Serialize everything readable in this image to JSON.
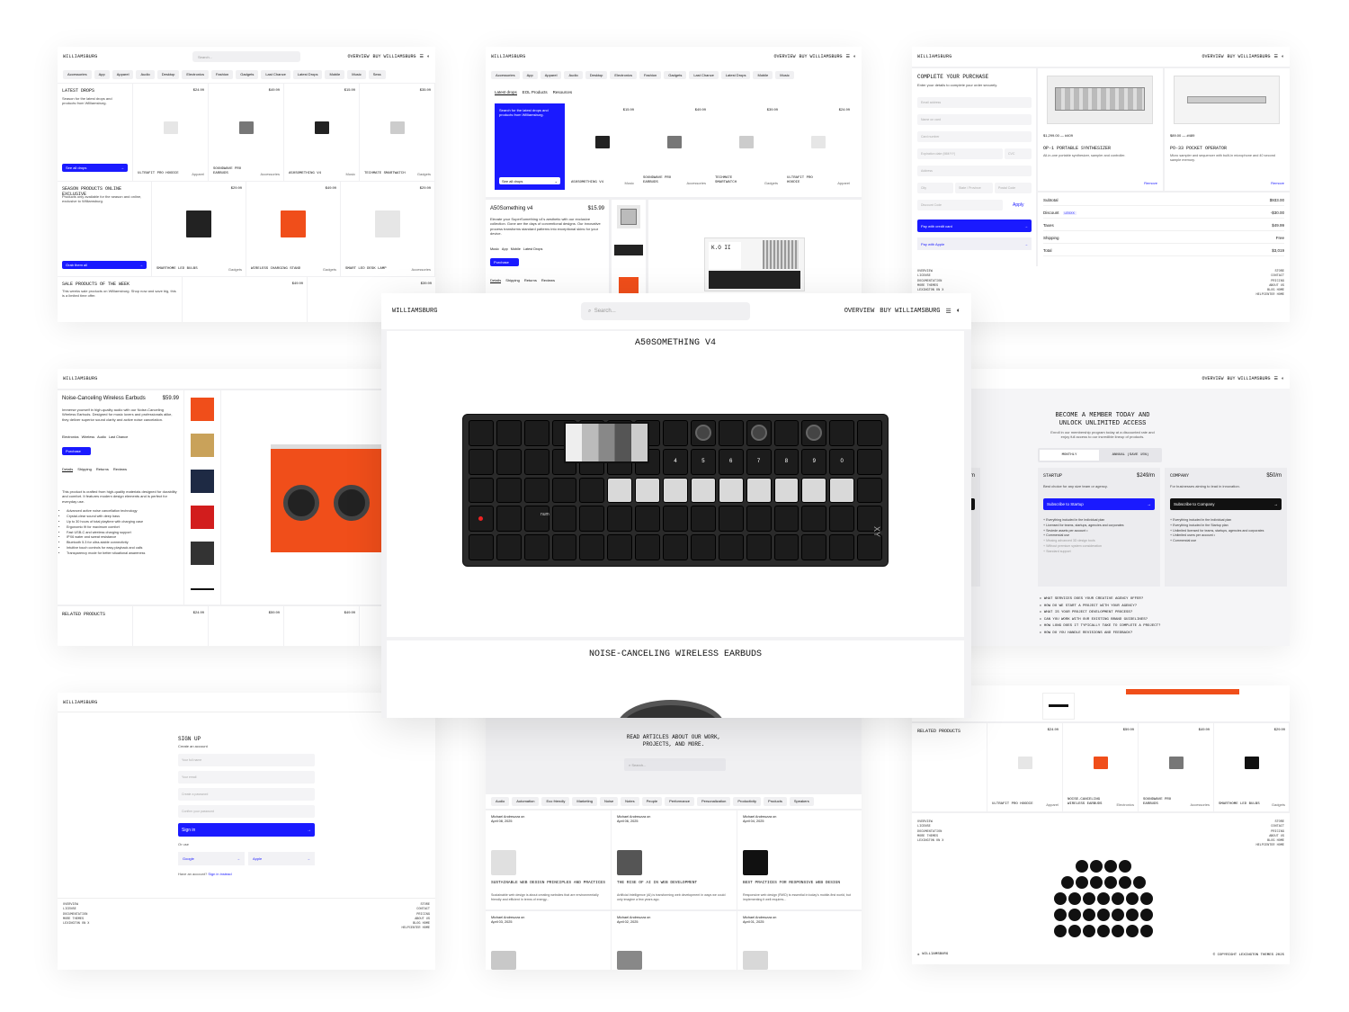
{
  "colors": {
    "accent": "#1a1aff",
    "orange": "#f04e1a",
    "bg": "#f0f0f2"
  },
  "brand": "WILLIAMSBURG",
  "nav": {
    "overview": "OVERVIEW",
    "buy": "BUY WILLIAMSBURG",
    "search_placeholder": "Search..."
  },
  "shop": {
    "chips": [
      "Accessories",
      "App",
      "Apparel",
      "Audio",
      "Desktop",
      "Electronics",
      "Fashion",
      "Gadgets",
      "Last Chance",
      "Latest Drops",
      "Mobile",
      "Music",
      "Sess"
    ],
    "latest_title": "LATEST DROPS",
    "latest_desc": "Season for the latest drops and products from Williamsburg.",
    "see_all": "See all drops",
    "row1": [
      {
        "price": "$24.99",
        "name": "ULTRAFIT PRO HOODIE",
        "cat": "Apparel"
      },
      {
        "price": "$49.99",
        "name": "SOUNDWAVE PRO EARBUDS",
        "cat": "Accessories"
      },
      {
        "price": "$15.99",
        "name": "A50SOMETHING V4",
        "cat": "Music"
      },
      {
        "price": "$35.99",
        "name": "TECHMATE SMARTWATCH",
        "cat": "Gadgets"
      }
    ],
    "season_title": "SEASON PRODUCTS ONLINE EXCLUSIVE",
    "season_desc": "Products only available for the season and online, exclusive to Williamsburg.",
    "grab": "Grab them all",
    "row2": [
      {
        "price": "$29.99",
        "name": "SMARTHOME LED BULBS",
        "cat": "Gadgets"
      },
      {
        "price": "$49.99",
        "name": "WIRELESS CHARGING STAND",
        "cat": "Gadgets"
      },
      {
        "price": "$29.99",
        "name": "SMART LED DESK LAMP",
        "cat": "Accessories"
      }
    ],
    "sale_title": "SALE PRODUCTS OF THE WEEK",
    "sale_desc": "This weeks sale products on Williamsburg. Shop now and save big, this is a limited time offer.",
    "sale_price1": "$49.99",
    "sale_price2": "$39.99"
  },
  "store": {
    "chips": [
      "Accessories",
      "App",
      "Apparel",
      "Audio",
      "Desktop",
      "Electronics",
      "Fashion",
      "Gadgets",
      "Last Chance",
      "Latest Drops",
      "Mobile",
      "Music"
    ],
    "tabs": [
      "Latest drops",
      "EOL Products",
      "Resources"
    ],
    "promo": "Search for the latest drops and products from Williamsburg.",
    "see_all": "See all drops",
    "items": [
      {
        "price": "$15.99",
        "name": "A50SOMETHING V4",
        "cat": "Music"
      },
      {
        "price": "$49.99",
        "name": "SOUNDWAVE PRO EARBUDS",
        "cat": "Accessories"
      },
      {
        "price": "$39.99",
        "name": "TECHMATE SMARTWATCH",
        "cat": "Gadgets"
      },
      {
        "price": "$24.99",
        "name": "ULTRAFIT PRO HOODIE",
        "cat": "Apparel"
      }
    ],
    "product_name": "A50Something v4",
    "product_price": "$15.99",
    "product_desc": "Elevate your SuperSomething v4's aesthetic with our exclusive collection. Gone are the days of conventional designs. Our innovative process transforms standard patterns into exceptional skins for your device.",
    "tags": [
      "Music",
      "App",
      "Mobile",
      "Latest Drops"
    ],
    "purchase": "Purchase",
    "detail_tabs": [
      "Details",
      "Shipping",
      "Returns",
      "Reviews"
    ]
  },
  "checkout": {
    "title": "COMPLETE YOUR PURCHASE",
    "subtitle": "Enter your details to complete your order securely.",
    "fields": [
      "Email address",
      "Name on card",
      "Card number",
      "Expiration date (MM/YY)",
      "CVC",
      "Address",
      "City",
      "State / Province",
      "Postal Code",
      "Discount Code"
    ],
    "apply": "Apply",
    "pay_card": "Pay with credit card",
    "pay_apple": "Pay with Apple",
    "items": [
      {
        "price": "$1,299.00 — #409",
        "name": "OP-1 PORTABLE SYNTHESIZER",
        "desc": "All-in-one portable synthesizer, sampler and controller.",
        "remove": "Remove"
      },
      {
        "price": "$89.00 — #489",
        "name": "PO-33 POCKET OPERATOR",
        "desc": "Micro sampler and sequencer with built-in microphone and 40 second sample memory.",
        "remove": "Remove"
      }
    ],
    "summary": [
      {
        "label": "Subtotal",
        "value": "$933.00"
      },
      {
        "label": "Discount",
        "value": "-$30.00",
        "badge": "LEXXX"
      },
      {
        "label": "Taxes",
        "value": "$49.99"
      },
      {
        "label": "Shipping",
        "value": "Free"
      },
      {
        "label": "Total",
        "value": "$3,019"
      }
    ]
  },
  "footer": {
    "left": [
      "OVERVIEW",
      "LICENSE",
      "DOCUMENTATION",
      "MORE THEMES",
      "LEXINGTON ON X"
    ],
    "right": [
      "STORE",
      "CONTACT",
      "PRICING",
      "ABOUT US",
      "BLOG HOME",
      "HELPCENTER HOME"
    ]
  },
  "earbuds": {
    "name": "Noise-Canceling Wireless Earbuds",
    "price": "$59.99",
    "desc": "Immerse yourself in high-quality audio with our Noise-Canceling Wireless Earbuds. Designed for music lovers and professionals alike, they deliver superior sound clarity and active noise cancelation.",
    "tags": [
      "Electronics",
      "Wireless",
      "Audio",
      "Last Chance"
    ],
    "purchase": "Purchase",
    "tabs": [
      "Details",
      "Shipping",
      "Returns",
      "Reviews"
    ],
    "detail": "This product is crafted from high-quality materials designed for durability and comfort. It features modern design elements and is perfect for everyday use.",
    "bullets": [
      "Advanced active noise cancellation technology",
      "Crystal-clear sound with deep bass",
      "Up to 30 hours of total playtime with charging case",
      "Ergonomic fit for maximum comfort",
      "Fast USB-C and wireless charging support",
      "IPX6 water and sweat resistance",
      "Bluetooth 5.3 for ultra-stable connectivity",
      "Intuitive touch controls for easy playback and calls",
      "Transparency mode for better situational awareness"
    ],
    "related": "RELATED PRODUCTS",
    "related_prices": [
      "$24.99",
      "$59.99",
      "$49.99"
    ]
  },
  "pricing": {
    "title": "BECOME A MEMBER TODAY AND UNLOCK UNLIMITED ACCESS",
    "subtitle": "Enroll in our membership program today at a discounted rate and enjoy full access to our incredible lineup of products.",
    "toggle": [
      "MONTHLY",
      "ANNUAL (SAVE 15%)"
    ],
    "plans": [
      {
        "name": "",
        "price": "$149/m",
        "desc": "ependent designers",
        "cta": "dual",
        "features": [
          "design assets",
          "ce and solo designer",
          "development",
          "design projects",
          "nt •",
          "Commercial use"
        ]
      },
      {
        "name": "STARTUP",
        "price": "$249/m",
        "desc": "Best choice for any size team or agency.",
        "cta": "Subscribe to Startup",
        "features": [
          "Everything included in the Individual plan",
          "Licensed for teams, startups, agencies and corporates",
          "Seviede assets per account •",
          "Commercial use",
          "Missing advanced 3D design tools",
          "Without premium system consideration",
          "Standard support"
        ]
      },
      {
        "name": "COMPANY",
        "price": "$50/m",
        "desc": "For businesses aiming to lead in innovation.",
        "cta": "Subscribe to Company",
        "features": [
          "Everything included in the Individual plan",
          "Everything included in the Startup plan",
          "Unlimited licensed for teams, startups, agencies and corporates",
          "Unlimited users per account •",
          "Commercial use"
        ]
      }
    ],
    "faq": [
      "WHAT SERVICES DOES YOUR CREATIVE AGENCY OFFER?",
      "HOW DO WE START A PROJECT WITH YOUR AGENCY?",
      "WHAT IS YOUR PROJECT DEVELOPMENT PROCESS?",
      "CAN YOU WORK WITH OUR EXISTING BRAND GUIDELINES?",
      "HOW LONG DOES IT TYPICALLY TAKE TO COMPLETE A PROJECT?",
      "HOW DO YOU HANDLE REVISIONS AND FEEDBACK?"
    ]
  },
  "signup": {
    "title": "SIGN UP",
    "subtitle": "Create an account",
    "fields": [
      "Your full name",
      "Your email",
      "Create a password",
      "Confirm your password"
    ],
    "sign_in": "Sign in",
    "or": "Or use",
    "google": "Google",
    "apple": "Apple",
    "have_account": "Have an account?",
    "sign_in_instead": "Sign in instead"
  },
  "blog": {
    "title": "READ ARTICLES ABOUT OUR WORK, PROJECTS, AND MORE.",
    "search": "Search...",
    "chips": [
      "Audio",
      "Automation",
      "Eco friendly",
      "Marketing",
      "Noise",
      "Notes",
      "People",
      "Performance",
      "Personalization",
      "Productivity",
      "Products",
      "Speakers"
    ],
    "posts": [
      {
        "author": "Michael Andreuzza on",
        "date": "April 08, 2025",
        "title": "SUSTAINABLE WEB DESIGN PRINCIPLES AND PRACTICES",
        "excerpt": "Sustainable web design is about creating websites that are environmentally friendly and efficient in terms of energy..."
      },
      {
        "author": "Michael Andreuzza on",
        "date": "April 06, 2025",
        "title": "THE RISE OF AI IN WEB DEVELOPMENT",
        "excerpt": "Artificial Intelligence (AI) is transforming web development in ways we could only imagine a few years ago."
      },
      {
        "author": "Michael Andreuzza on",
        "date": "April 04, 2025",
        "title": "BEST PRACTICES FOR RESPONSIVE WEB DESIGN",
        "excerpt": "Responsive web design (RWD) is essential in today's mobile-first world, but implementing it well requires..."
      }
    ],
    "row2": [
      {
        "author": "Michael Andreuzza on",
        "date": "April 03, 2025"
      },
      {
        "author": "Michael Andreuzza on",
        "date": "April 02, 2025"
      },
      {
        "author": "Michael Andreuzza on",
        "date": "April 01, 2025"
      }
    ]
  },
  "related_page": {
    "title": "RELATED PRODUCTS",
    "items": [
      {
        "price": "$24.99",
        "name": "ULTRAFIT PRO HOODIE",
        "cat": "Apparel"
      },
      {
        "price": "$59.99",
        "name": "NOISE-CANCELING WIRELESS EARBUDS",
        "cat": "Electronics"
      },
      {
        "price": "$49.99",
        "name": "SOUNDWAVE PRO EARBUDS",
        "cat": "Accessories"
      },
      {
        "price": "$29.99",
        "name": "SMARTHOME LED BULBS",
        "cat": "Gadgets"
      }
    ],
    "copyright": "© COPYRIGHT LEXINGTON THEMES 2025"
  },
  "hero": {
    "brand": "WILLIAMSBURG",
    "search": "Search...",
    "overview": "OVERVIEW",
    "buy": "BUY WILLIAMSBURG",
    "product1": "A50SOMETHING V4",
    "product2": "NOISE-CANCELING WIRELESS EARBUDS",
    "device_label": "num",
    "device_model": "XY"
  }
}
